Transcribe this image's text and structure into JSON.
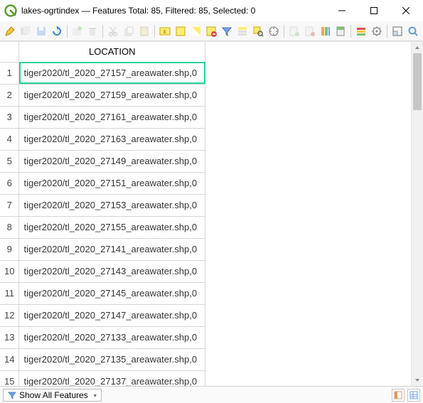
{
  "window": {
    "title": "lakes-ogrtindex — Features Total: 85, Filtered: 85, Selected: 0"
  },
  "table": {
    "header": {
      "location": "LOCATION"
    },
    "rows": [
      {
        "n": "1",
        "loc": "tiger2020/tl_2020_27157_areawater.shp,0"
      },
      {
        "n": "2",
        "loc": "tiger2020/tl_2020_27159_areawater.shp,0"
      },
      {
        "n": "3",
        "loc": "tiger2020/tl_2020_27161_areawater.shp,0"
      },
      {
        "n": "4",
        "loc": "tiger2020/tl_2020_27163_areawater.shp,0"
      },
      {
        "n": "5",
        "loc": "tiger2020/tl_2020_27149_areawater.shp,0"
      },
      {
        "n": "6",
        "loc": "tiger2020/tl_2020_27151_areawater.shp,0"
      },
      {
        "n": "7",
        "loc": "tiger2020/tl_2020_27153_areawater.shp,0"
      },
      {
        "n": "8",
        "loc": "tiger2020/tl_2020_27155_areawater.shp,0"
      },
      {
        "n": "9",
        "loc": "tiger2020/tl_2020_27141_areawater.shp,0"
      },
      {
        "n": "10",
        "loc": "tiger2020/tl_2020_27143_areawater.shp,0"
      },
      {
        "n": "11",
        "loc": "tiger2020/tl_2020_27145_areawater.shp,0"
      },
      {
        "n": "12",
        "loc": "tiger2020/tl_2020_27147_areawater.shp,0"
      },
      {
        "n": "13",
        "loc": "tiger2020/tl_2020_27133_areawater.shp,0"
      },
      {
        "n": "14",
        "loc": "tiger2020/tl_2020_27135_areawater.shp,0"
      },
      {
        "n": "15",
        "loc": "tiger2020/tl_2020_27137_areawater.shp,0"
      }
    ],
    "selected_row_index": 0
  },
  "statusbar": {
    "filter_label": "Show All Features"
  },
  "colors": {
    "selection": "#24d39b"
  }
}
